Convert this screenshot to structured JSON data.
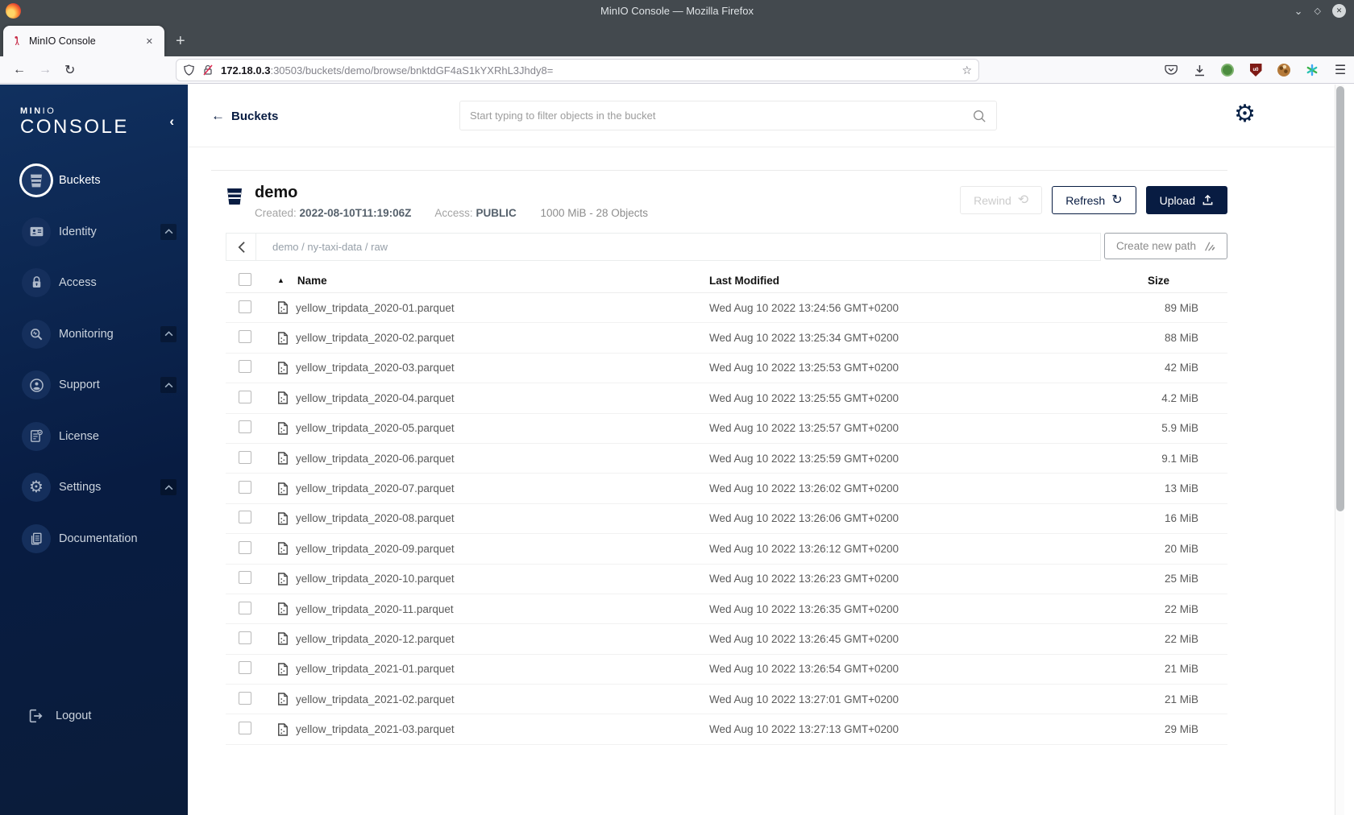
{
  "browser": {
    "window_title": "MinIO Console — Mozilla Firefox",
    "tab": {
      "title": "MinIO Console",
      "close_glyph": "✕"
    },
    "new_tab_glyph": "+",
    "url": {
      "host": "172.18.0.3",
      "rest": ":30503/buckets/demo/browse/bnktdGF4aS1kYXRhL3Jhdy8="
    },
    "window_controls": {
      "minimize": "⌄",
      "maximize": "◇",
      "close": "✕"
    },
    "nav": {
      "back": "←",
      "forward": "→",
      "reload": "↻"
    },
    "bookmark_star": "☆",
    "menu_glyph": "☰"
  },
  "sidebar": {
    "logo": {
      "min": "MIN",
      "io": "IO",
      "console": "CONSOLE"
    },
    "collapse_glyph": "‹",
    "items": [
      {
        "id": "buckets",
        "label": "Buckets",
        "icon": "bucket-icon",
        "active": true,
        "expandable": false
      },
      {
        "id": "identity",
        "label": "Identity",
        "icon": "identity-icon",
        "active": false,
        "expandable": true
      },
      {
        "id": "access",
        "label": "Access",
        "icon": "lock-icon",
        "active": false,
        "expandable": false
      },
      {
        "id": "monitoring",
        "label": "Monitoring",
        "icon": "monitoring-icon",
        "active": false,
        "expandable": true
      },
      {
        "id": "support",
        "label": "Support",
        "icon": "support-icon",
        "active": false,
        "expandable": true
      },
      {
        "id": "license",
        "label": "License",
        "icon": "license-icon",
        "active": false,
        "expandable": false
      },
      {
        "id": "settings",
        "label": "Settings",
        "icon": "gear-icon",
        "active": false,
        "expandable": true
      },
      {
        "id": "documentation",
        "label": "Documentation",
        "icon": "documentation-icon",
        "active": false,
        "expandable": false
      }
    ],
    "logout": {
      "label": "Logout"
    }
  },
  "header": {
    "back_label": "Buckets",
    "search_placeholder": "Start typing to filter objects in the bucket"
  },
  "bucket": {
    "name": "demo",
    "created_label": "Created:",
    "created_value": "2022-08-10T11:19:06Z",
    "access_label": "Access:",
    "access_value": "PUBLIC",
    "usage": "1000 MiB - 28 Objects",
    "rewind_label": "Rewind",
    "refresh_label": "Refresh",
    "upload_label": "Upload"
  },
  "path_bar": {
    "breadcrumb": "demo / ny-taxi-data / raw",
    "create_label": "Create new path"
  },
  "table": {
    "sort_asc_glyph": "▲",
    "columns": {
      "name": "Name",
      "modified": "Last Modified",
      "size": "Size"
    },
    "rows": [
      {
        "name": "yellow_tripdata_2020-01.parquet",
        "modified": "Wed Aug 10 2022 13:24:56 GMT+0200",
        "size": "89 MiB"
      },
      {
        "name": "yellow_tripdata_2020-02.parquet",
        "modified": "Wed Aug 10 2022 13:25:34 GMT+0200",
        "size": "88 MiB"
      },
      {
        "name": "yellow_tripdata_2020-03.parquet",
        "modified": "Wed Aug 10 2022 13:25:53 GMT+0200",
        "size": "42 MiB"
      },
      {
        "name": "yellow_tripdata_2020-04.parquet",
        "modified": "Wed Aug 10 2022 13:25:55 GMT+0200",
        "size": "4.2 MiB"
      },
      {
        "name": "yellow_tripdata_2020-05.parquet",
        "modified": "Wed Aug 10 2022 13:25:57 GMT+0200",
        "size": "5.9 MiB"
      },
      {
        "name": "yellow_tripdata_2020-06.parquet",
        "modified": "Wed Aug 10 2022 13:25:59 GMT+0200",
        "size": "9.1 MiB"
      },
      {
        "name": "yellow_tripdata_2020-07.parquet",
        "modified": "Wed Aug 10 2022 13:26:02 GMT+0200",
        "size": "13 MiB"
      },
      {
        "name": "yellow_tripdata_2020-08.parquet",
        "modified": "Wed Aug 10 2022 13:26:06 GMT+0200",
        "size": "16 MiB"
      },
      {
        "name": "yellow_tripdata_2020-09.parquet",
        "modified": "Wed Aug 10 2022 13:26:12 GMT+0200",
        "size": "20 MiB"
      },
      {
        "name": "yellow_tripdata_2020-10.parquet",
        "modified": "Wed Aug 10 2022 13:26:23 GMT+0200",
        "size": "25 MiB"
      },
      {
        "name": "yellow_tripdata_2020-11.parquet",
        "modified": "Wed Aug 10 2022 13:26:35 GMT+0200",
        "size": "22 MiB"
      },
      {
        "name": "yellow_tripdata_2020-12.parquet",
        "modified": "Wed Aug 10 2022 13:26:45 GMT+0200",
        "size": "22 MiB"
      },
      {
        "name": "yellow_tripdata_2021-01.parquet",
        "modified": "Wed Aug 10 2022 13:26:54 GMT+0200",
        "size": "21 MiB"
      },
      {
        "name": "yellow_tripdata_2021-02.parquet",
        "modified": "Wed Aug 10 2022 13:27:01 GMT+0200",
        "size": "21 MiB"
      },
      {
        "name": "yellow_tripdata_2021-03.parquet",
        "modified": "Wed Aug 10 2022 13:27:13 GMT+0200",
        "size": "29 MiB"
      }
    ]
  }
}
